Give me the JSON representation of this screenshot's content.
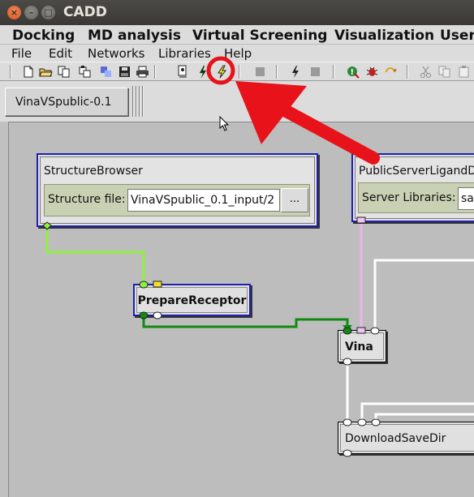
{
  "window": {
    "title": "CADD",
    "close_glyph": "×",
    "min_glyph": "–",
    "max_glyph": "□"
  },
  "top_menu": {
    "docking": "Docking",
    "md_analysis": "MD analysis",
    "virtual_screening": "Virtual Screening",
    "visualization": "Visualization",
    "user": "User"
  },
  "menubar": {
    "file": "File",
    "edit": "Edit",
    "networks": "Networks",
    "libraries": "Libraries",
    "help": "Help"
  },
  "toolbar": {
    "icons": [
      "new-file-icon",
      "open-folder-icon",
      "copy-icon",
      "paste-icon",
      "merge-icon",
      "save-icon",
      "print-icon",
      "run-icon",
      "run-all-icon",
      "stop-icon",
      "lightning-icon",
      "pause-icon",
      "error-icon",
      "bug-icon",
      "refresh-icon",
      "cut-icon",
      "copy2-icon",
      "paste2-icon"
    ],
    "highlighted": "run-all-icon"
  },
  "tab": {
    "label": "VinaVSpublic-0.1"
  },
  "nodes": {
    "structure_browser": {
      "title": "StructureBrowser",
      "param_label": "Structure file:",
      "param_value": "VinaVSpublic_0.1_input/2",
      "more_button": "..."
    },
    "public_server": {
      "title": "PublicServerLigandDB",
      "param_label": "Server Libraries:",
      "param_value": "sa"
    },
    "prepare_receptor": {
      "title": "PrepareReceptor"
    },
    "vina": {
      "title": "Vina"
    },
    "download_save_dir": {
      "title": "DownloadSaveDir"
    }
  },
  "colors": {
    "annotation_red": "#e8121a",
    "node_border": "#1f1fb0",
    "wire_light_green": "#8cf23c",
    "wire_dark_green": "#118a11",
    "wire_pink": "#e9b6e9",
    "wire_white": "#ffffff"
  }
}
